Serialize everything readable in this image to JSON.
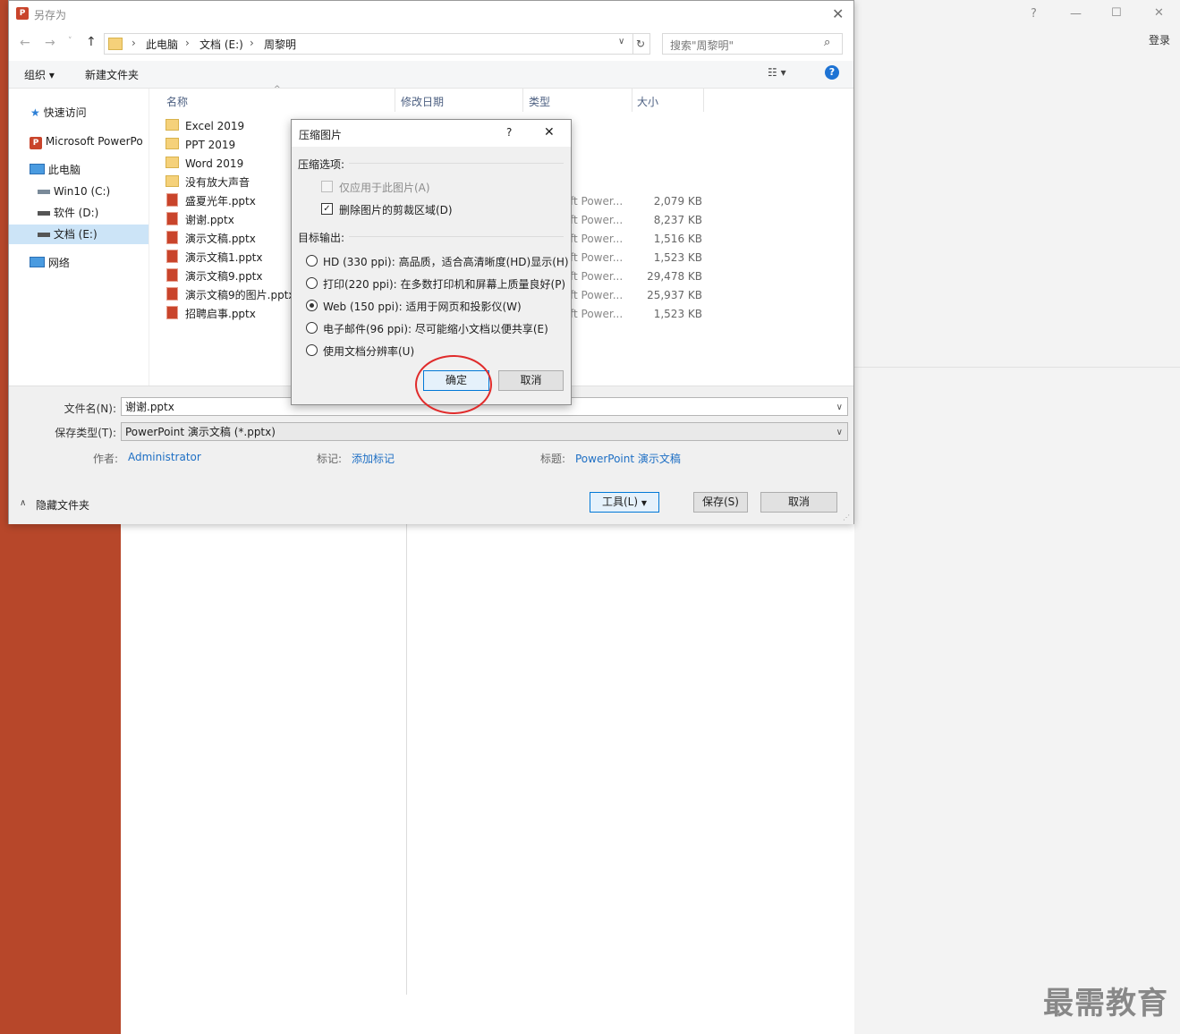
{
  "app": {
    "login": "登录",
    "window_help": "?",
    "minimize": "—",
    "restore": "☐",
    "close": "✕",
    "watermark": "最需教育"
  },
  "save_dialog": {
    "title": "另存为",
    "app_icon": "P",
    "close": "✕",
    "breadcrumb": [
      "此电脑",
      "文档 (E:)",
      "周黎明"
    ],
    "breadcrumb_sep": "›",
    "search_placeholder": "搜索\"周黎明\"",
    "toolbar": {
      "organize": "组织 ▾",
      "new_folder": "新建文件夹",
      "view": "☷ ▾",
      "help": "?"
    },
    "nav": [
      {
        "label": "快速访问",
        "icon": "star-icon"
      },
      {
        "label": "Microsoft PowerPo",
        "icon": "powerpoint-icon"
      },
      {
        "label": "此电脑",
        "icon": "computer-icon"
      },
      {
        "label": "Win10 (C:)",
        "icon": "drive-icon"
      },
      {
        "label": "软件 (D:)",
        "icon": "drive-icon"
      },
      {
        "label": "文档 (E:)",
        "icon": "drive-icon"
      },
      {
        "label": "网络",
        "icon": "network-icon"
      }
    ],
    "columns": {
      "name": "名称",
      "date": "修改日期",
      "type": "类型",
      "size": "大小"
    },
    "files": [
      {
        "name": "Excel 2019",
        "kind": "folder",
        "type": "",
        "size": ""
      },
      {
        "name": "PPT 2019",
        "kind": "folder",
        "type": "",
        "size": ""
      },
      {
        "name": "Word 2019",
        "kind": "folder",
        "type": "",
        "size": ""
      },
      {
        "name": "没有放大声音",
        "kind": "folder",
        "type": "",
        "size": ""
      },
      {
        "name": "盛夏光年.pptx",
        "kind": "pptx",
        "type": "ft Power...",
        "size": "2,079 KB"
      },
      {
        "name": "谢谢.pptx",
        "kind": "pptx",
        "type": "ft Power...",
        "size": "8,237 KB"
      },
      {
        "name": "演示文稿.pptx",
        "kind": "pptx",
        "type": "ft Power...",
        "size": "1,516 KB"
      },
      {
        "name": "演示文稿1.pptx",
        "kind": "pptx",
        "type": "ft Power...",
        "size": "1,523 KB"
      },
      {
        "name": "演示文稿9.pptx",
        "kind": "pptx",
        "type": "ft Power...",
        "size": "29,478 KB"
      },
      {
        "name": "演示文稿9的图片.pptx",
        "kind": "pptx",
        "type": "ft Power...",
        "size": "25,937 KB"
      },
      {
        "name": "招聘启事.pptx",
        "kind": "pptx",
        "type": "ft Power...",
        "size": "1,523 KB"
      }
    ],
    "filename_label": "文件名(N):",
    "filename_value": "谢谢.pptx",
    "filetype_label": "保存类型(T):",
    "filetype_value": "PowerPoint 演示文稿 (*.pptx)",
    "author_label": "作者:",
    "author_value": "Administrator",
    "tags_label": "标记:",
    "tags_value": "添加标记",
    "title_label": "标题:",
    "title_value": "PowerPoint 演示文稿",
    "hide_folders": "隐藏文件夹",
    "tools_button": "工具(L)",
    "save_button": "保存(S)",
    "cancel_button": "取消"
  },
  "compress_dialog": {
    "title": "压缩图片",
    "help": "?",
    "close": "✕",
    "options_label": "压缩选项:",
    "apply_only_this": "仅应用于此图片(A)",
    "apply_only_this_checked": false,
    "delete_cropped": "删除图片的剪裁区域(D)",
    "delete_cropped_checked": true,
    "output_label": "目标输出:",
    "outputs": [
      {
        "label": "HD (330 ppi): 高品质，适合高清晰度(HD)显示(H)",
        "selected": false
      },
      {
        "label": "打印(220 ppi): 在多数打印机和屏幕上质量良好(P)",
        "selected": false
      },
      {
        "label": "Web (150 ppi): 适用于网页和投影仪(W)",
        "selected": true
      },
      {
        "label": "电子邮件(96 ppi): 尽可能缩小文档以便共享(E)",
        "selected": false
      },
      {
        "label": "使用文档分辨率(U)",
        "selected": false
      }
    ],
    "ok_button": "确定",
    "cancel_button": "取消",
    "highlight_color": "#e02b2b"
  }
}
